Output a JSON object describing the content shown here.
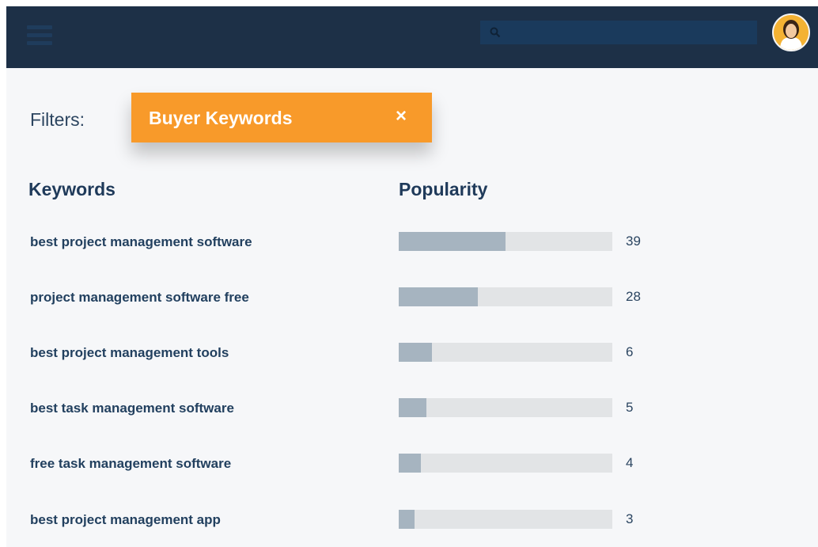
{
  "header": {
    "menu_icon": "hamburger-icon",
    "search": {
      "icon": "search-icon",
      "placeholder": ""
    },
    "avatar_icon": "user-avatar"
  },
  "filters": {
    "label": "Filters:",
    "chip": {
      "label": "Buyer Keywords",
      "close": "×"
    }
  },
  "table": {
    "headers": {
      "keywords": "Keywords",
      "popularity": "Popularity"
    },
    "max": 100,
    "rows": [
      {
        "keyword": "best project management software",
        "value": "39",
        "pct": 0.5
      },
      {
        "keyword": "project management software free",
        "value": "28",
        "pct": 0.37
      },
      {
        "keyword": "best project management tools",
        "value": "6",
        "pct": 0.155
      },
      {
        "keyword": "best task management software",
        "value": "5",
        "pct": 0.13
      },
      {
        "keyword": "free task management software",
        "value": "4",
        "pct": 0.105
      },
      {
        "keyword": "best project management app",
        "value": "3",
        "pct": 0.075
      }
    ]
  },
  "colors": {
    "topbar": "#1d3047",
    "chip": "#f89a2a",
    "bar_fill": "#a6b4c0",
    "bar_track": "#e2e4e6",
    "text": "#22405f"
  }
}
